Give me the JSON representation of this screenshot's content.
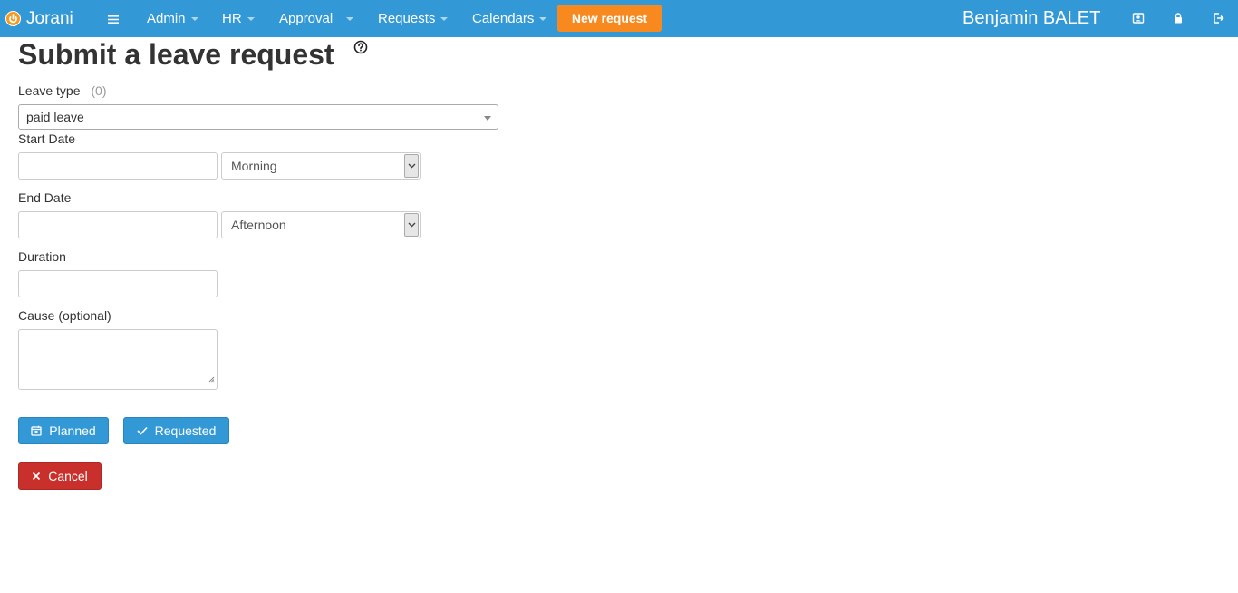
{
  "navbar": {
    "brand": "Jorani",
    "menu_items": [
      {
        "label": "Admin"
      },
      {
        "label": "HR"
      },
      {
        "label": "Approval"
      },
      {
        "label": "Requests"
      },
      {
        "label": "Calendars"
      }
    ],
    "new_request_label": "New request",
    "user_name": "Benjamin BALET",
    "colors": {
      "background": "#3399d6",
      "new_request": "#f7891f"
    },
    "right_icons": [
      "profile-icon",
      "lock-icon",
      "logout-icon"
    ]
  },
  "form": {
    "title": "Submit a leave request",
    "leave_type_label": "Leave type",
    "leave_type_count": "(0)",
    "leave_type_value": "paid leave",
    "start_date_label": "Start Date",
    "start_date_value": "",
    "start_half_value": "Morning",
    "end_date_label": "End Date",
    "end_date_value": "",
    "end_half_value": "Afternoon",
    "duration_label": "Duration",
    "duration_value": "",
    "cause_label": "Cause (optional)",
    "cause_value": "",
    "planned_label": "Planned",
    "requested_label": "Requested",
    "cancel_label": "Cancel",
    "colors": {
      "primary": "#3399d6",
      "danger": "#c9302c"
    }
  }
}
